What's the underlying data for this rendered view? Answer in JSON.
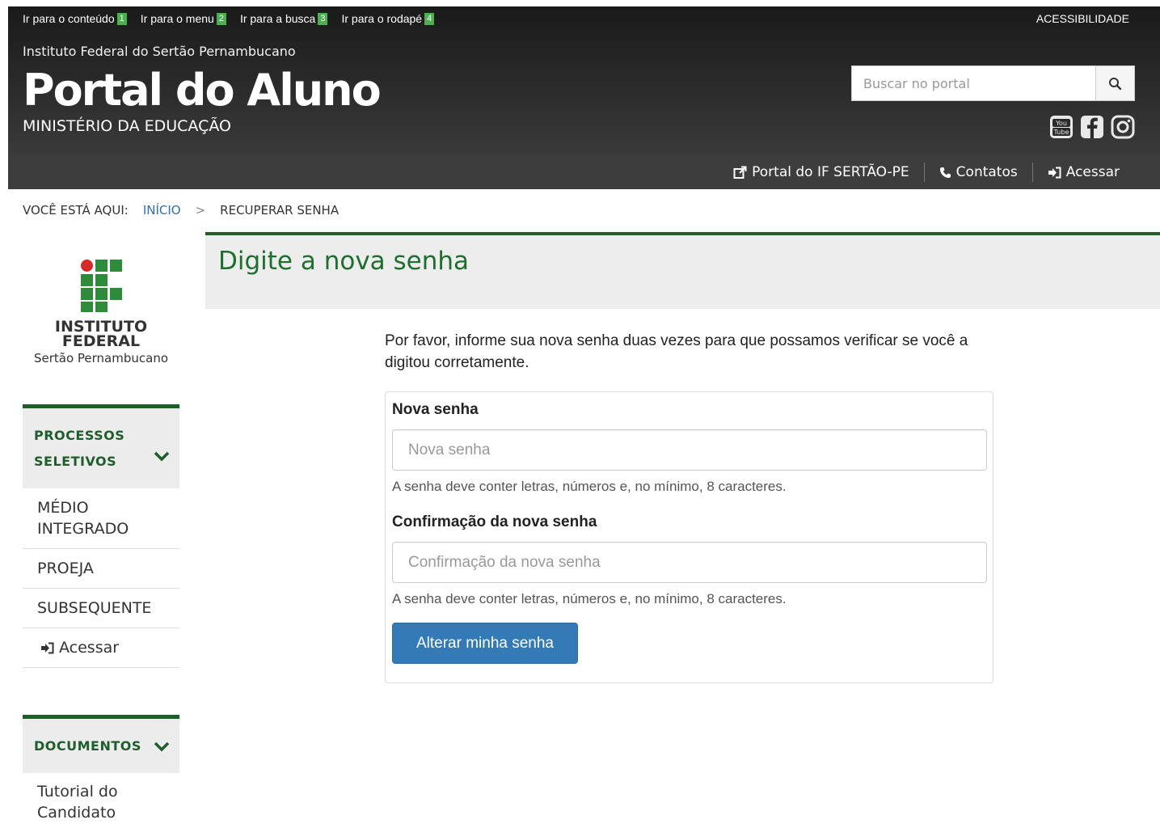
{
  "header": {
    "skip_links": [
      {
        "label": "Ir para o conteúdo",
        "key": "1"
      },
      {
        "label": "Ir para o menu",
        "key": "2"
      },
      {
        "label": "Ir para a busca",
        "key": "3"
      },
      {
        "label": "Ir para o rodapé",
        "key": "4"
      }
    ],
    "accessibility": "ACESSIBILIDADE",
    "institution": "Instituto Federal do Sertão Pernambucano",
    "title": "Portal do Aluno",
    "ministry": "MINISTÉRIO DA EDUCAÇÃO",
    "search_placeholder": "Buscar no portal",
    "social": [
      "youtube-icon",
      "facebook-icon",
      "instagram-icon"
    ]
  },
  "navbar": {
    "items": [
      {
        "label": "Portal do IF SERTÃO-PE",
        "icon": "external-link-icon"
      },
      {
        "label": "Contatos",
        "icon": "phone-icon"
      },
      {
        "label": "Acessar",
        "icon": "login-icon"
      }
    ]
  },
  "breadcrumb": {
    "prefix": "VOCÊ ESTÁ AQUI:",
    "home": "INÍCIO",
    "separator": ">",
    "current": "RECUPERAR SENHA"
  },
  "logo": {
    "line1": "INSTITUTO",
    "line2": "FEDERAL",
    "line3": "Sertão Pernambucano"
  },
  "sidebar": {
    "processos": {
      "title_line1": "PROCESSOS",
      "title_line2": "SELETIVOS",
      "items": [
        "MÉDIO INTEGRADO",
        "PROEJA",
        "SUBSEQUENTE",
        "Acessar"
      ]
    },
    "documentos": {
      "title": "DOCUMENTOS",
      "items": [
        "Tutorial do Candidato"
      ]
    }
  },
  "main": {
    "title": "Digite a nova senha",
    "intro": "Por favor, informe sua nova senha duas vezes para que possamos verificar se você a digitou corretamente.",
    "new_password": {
      "label": "Nova senha",
      "placeholder": "Nova senha",
      "help": "A senha deve conter letras, números e, no mínimo, 8 caracteres."
    },
    "confirm_password": {
      "label": "Confirmação da nova senha",
      "placeholder": "Confirmação da nova senha",
      "help": "A senha deve conter letras, números e, no mínimo, 8 caracteres."
    },
    "submit": "Alterar minha senha"
  },
  "colors": {
    "brand_green": "#1e5e2a",
    "link_blue": "#2f6fb0",
    "button_blue": "#337ab7",
    "header_dark": "#2b2b2b"
  }
}
